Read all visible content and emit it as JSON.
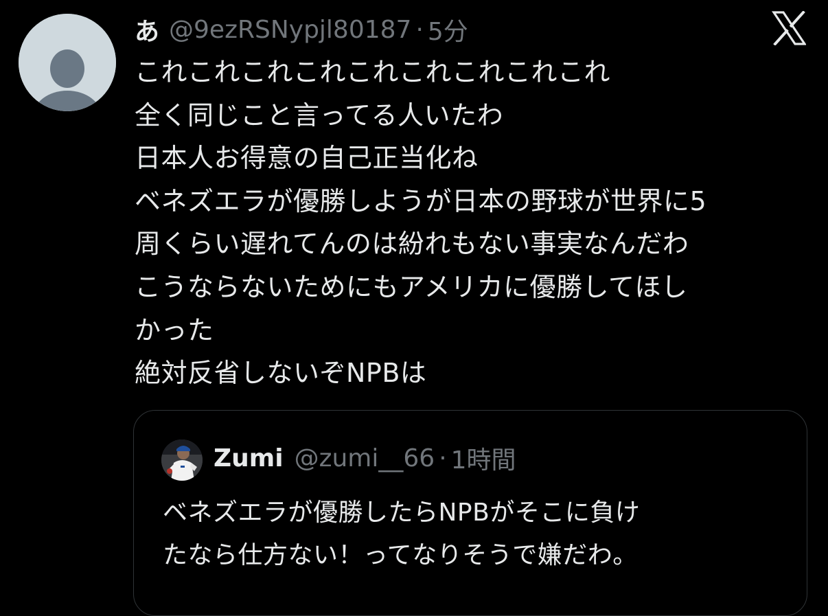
{
  "tweet": {
    "display_name": "あ",
    "handle": "@9ezRSNypjl80187",
    "separator": "·",
    "time": "5分",
    "lines": [
      "これこれこれこれこれこれこれこれこれ",
      "全く同じこと言ってる人いたわ",
      "日本人お得意の自己正当化ね",
      "ベネズエラが優勝しようが日本の野球が世界に5",
      "周くらい遅れてんのは紛れもない事実なんだわ",
      "こうならないためにもアメリカに優勝してほし",
      "かった",
      "絶対反省しないぞNPBは"
    ]
  },
  "quoted_tweet": {
    "display_name": "Zumi",
    "handle": "@zumi__66",
    "separator": "·",
    "time": "1時間",
    "lines": [
      "ベネズエラが優勝したらNPBがそこに負け",
      "たなら仕方ない！ってなりそうで嫌だわ。"
    ]
  },
  "icons": {
    "avatar": "default-avatar-icon",
    "brand": "x-logo-icon"
  },
  "colors": {
    "background": "#000000",
    "primary_text": "#e7e9ea",
    "secondary_text": "#71767b",
    "border": "#2f3336",
    "default_avatar_bg": "#cfd9de",
    "default_avatar_fg": "#6a7885"
  }
}
